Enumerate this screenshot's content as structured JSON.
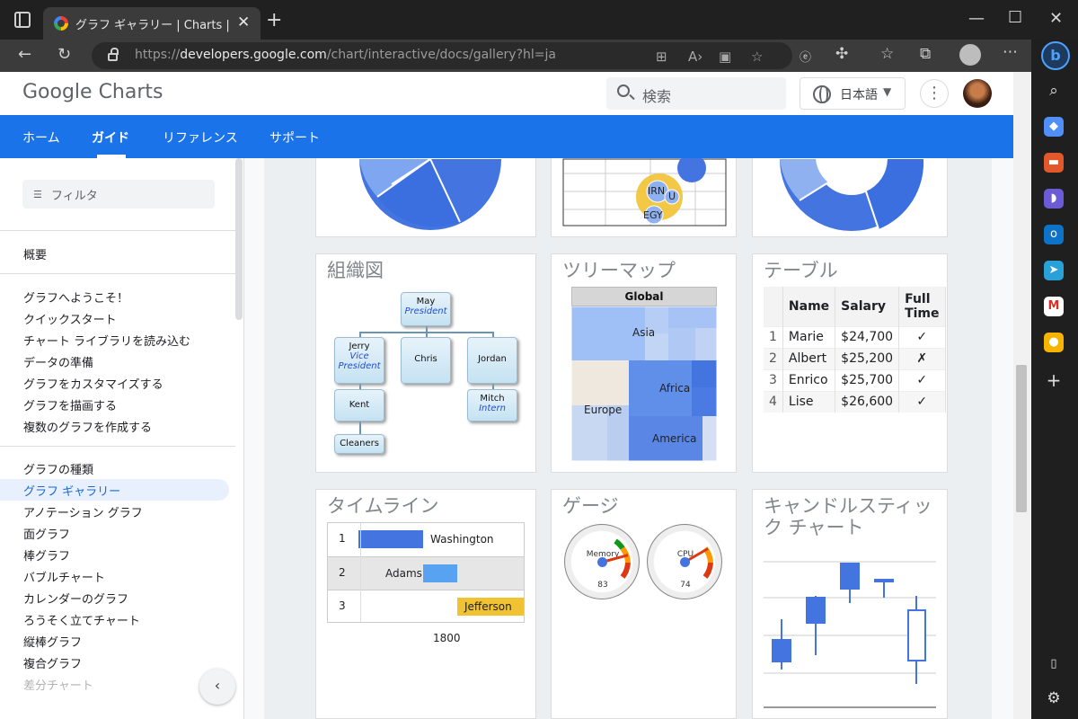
{
  "browser": {
    "tab_title": "グラフ ギャラリー | Charts | Google for Developers",
    "url_prefix": "https://",
    "url_host": "developers.google.com",
    "url_path": "/chart/interactive/docs/gallery?hl=ja"
  },
  "header": {
    "logo": "Google Charts",
    "search_placeholder": "検索",
    "language": "日本語"
  },
  "nav": {
    "tabs": [
      "ホーム",
      "ガイド",
      "リファレンス",
      "サポート"
    ],
    "active": "ガイド"
  },
  "sidebar": {
    "filter_placeholder": "フィルタ",
    "overview": "概要",
    "getting_started": [
      "グラフへようこそ！",
      "クイックスタート",
      "チャート ライブラリを読み込む",
      "データの準備",
      "グラフをカスタマイズする",
      "グラフを描画する",
      "複数のグラフを作成する"
    ],
    "chart_types": [
      "グラフの種類",
      "グラフ ギャラリー",
      "アノテーション グラフ",
      "面グラフ",
      "棒グラフ",
      "バブルチャート",
      "カレンダーのグラフ",
      "ろうそく立てチャート",
      "縦棒グラフ",
      "複合グラフ",
      "差分チャート"
    ],
    "active_item": "グラフ ギャラリー"
  },
  "cards": {
    "orgchart": {
      "title": "組織図",
      "nodes": {
        "may": "May",
        "may_role": "President",
        "jerry": "Jerry",
        "jerry_role": "Vice President",
        "chris": "Chris",
        "jordan": "Jordan",
        "kent": "Kent",
        "mitch": "Mitch",
        "mitch_role": "Intern",
        "cleaners": "Cleaners"
      }
    },
    "treemap": {
      "title": "ツリーマップ",
      "root": "Global",
      "regions": [
        "Asia",
        "Europe",
        "Africa",
        "America"
      ]
    },
    "table": {
      "title": "テーブル",
      "columns": [
        "Name",
        "Salary",
        "Full Time"
      ],
      "rows": [
        {
          "n": "1",
          "name": "Marie",
          "salary": "$24,700",
          "ft": "✓"
        },
        {
          "n": "2",
          "name": "Albert",
          "salary": "$25,200",
          "ft": "✗"
        },
        {
          "n": "3",
          "name": "Enrico",
          "salary": "$25,700",
          "ft": "✓"
        },
        {
          "n": "4",
          "name": "Lise",
          "salary": "$26,600",
          "ft": "✓"
        }
      ]
    },
    "timeline": {
      "title": "タイムライン",
      "rows": [
        {
          "n": "1",
          "label": "Washington"
        },
        {
          "n": "2",
          "label": "Adams"
        },
        {
          "n": "3",
          "label": "Jefferson"
        }
      ],
      "axis_label": "1800"
    },
    "gauge": {
      "title": "ゲージ",
      "gauges": [
        {
          "label": "Memory",
          "value": "83"
        },
        {
          "label": "CPU",
          "value": "74"
        }
      ]
    },
    "candlestick": {
      "title": "キャンドルスティック チャート"
    },
    "bubble_labels": [
      "IRN",
      "EGY",
      "U"
    ]
  },
  "colors": {
    "nav_blue": "#1a73e8",
    "chart_blue": "#4374e0",
    "timeline_gold": "#f1c232"
  }
}
